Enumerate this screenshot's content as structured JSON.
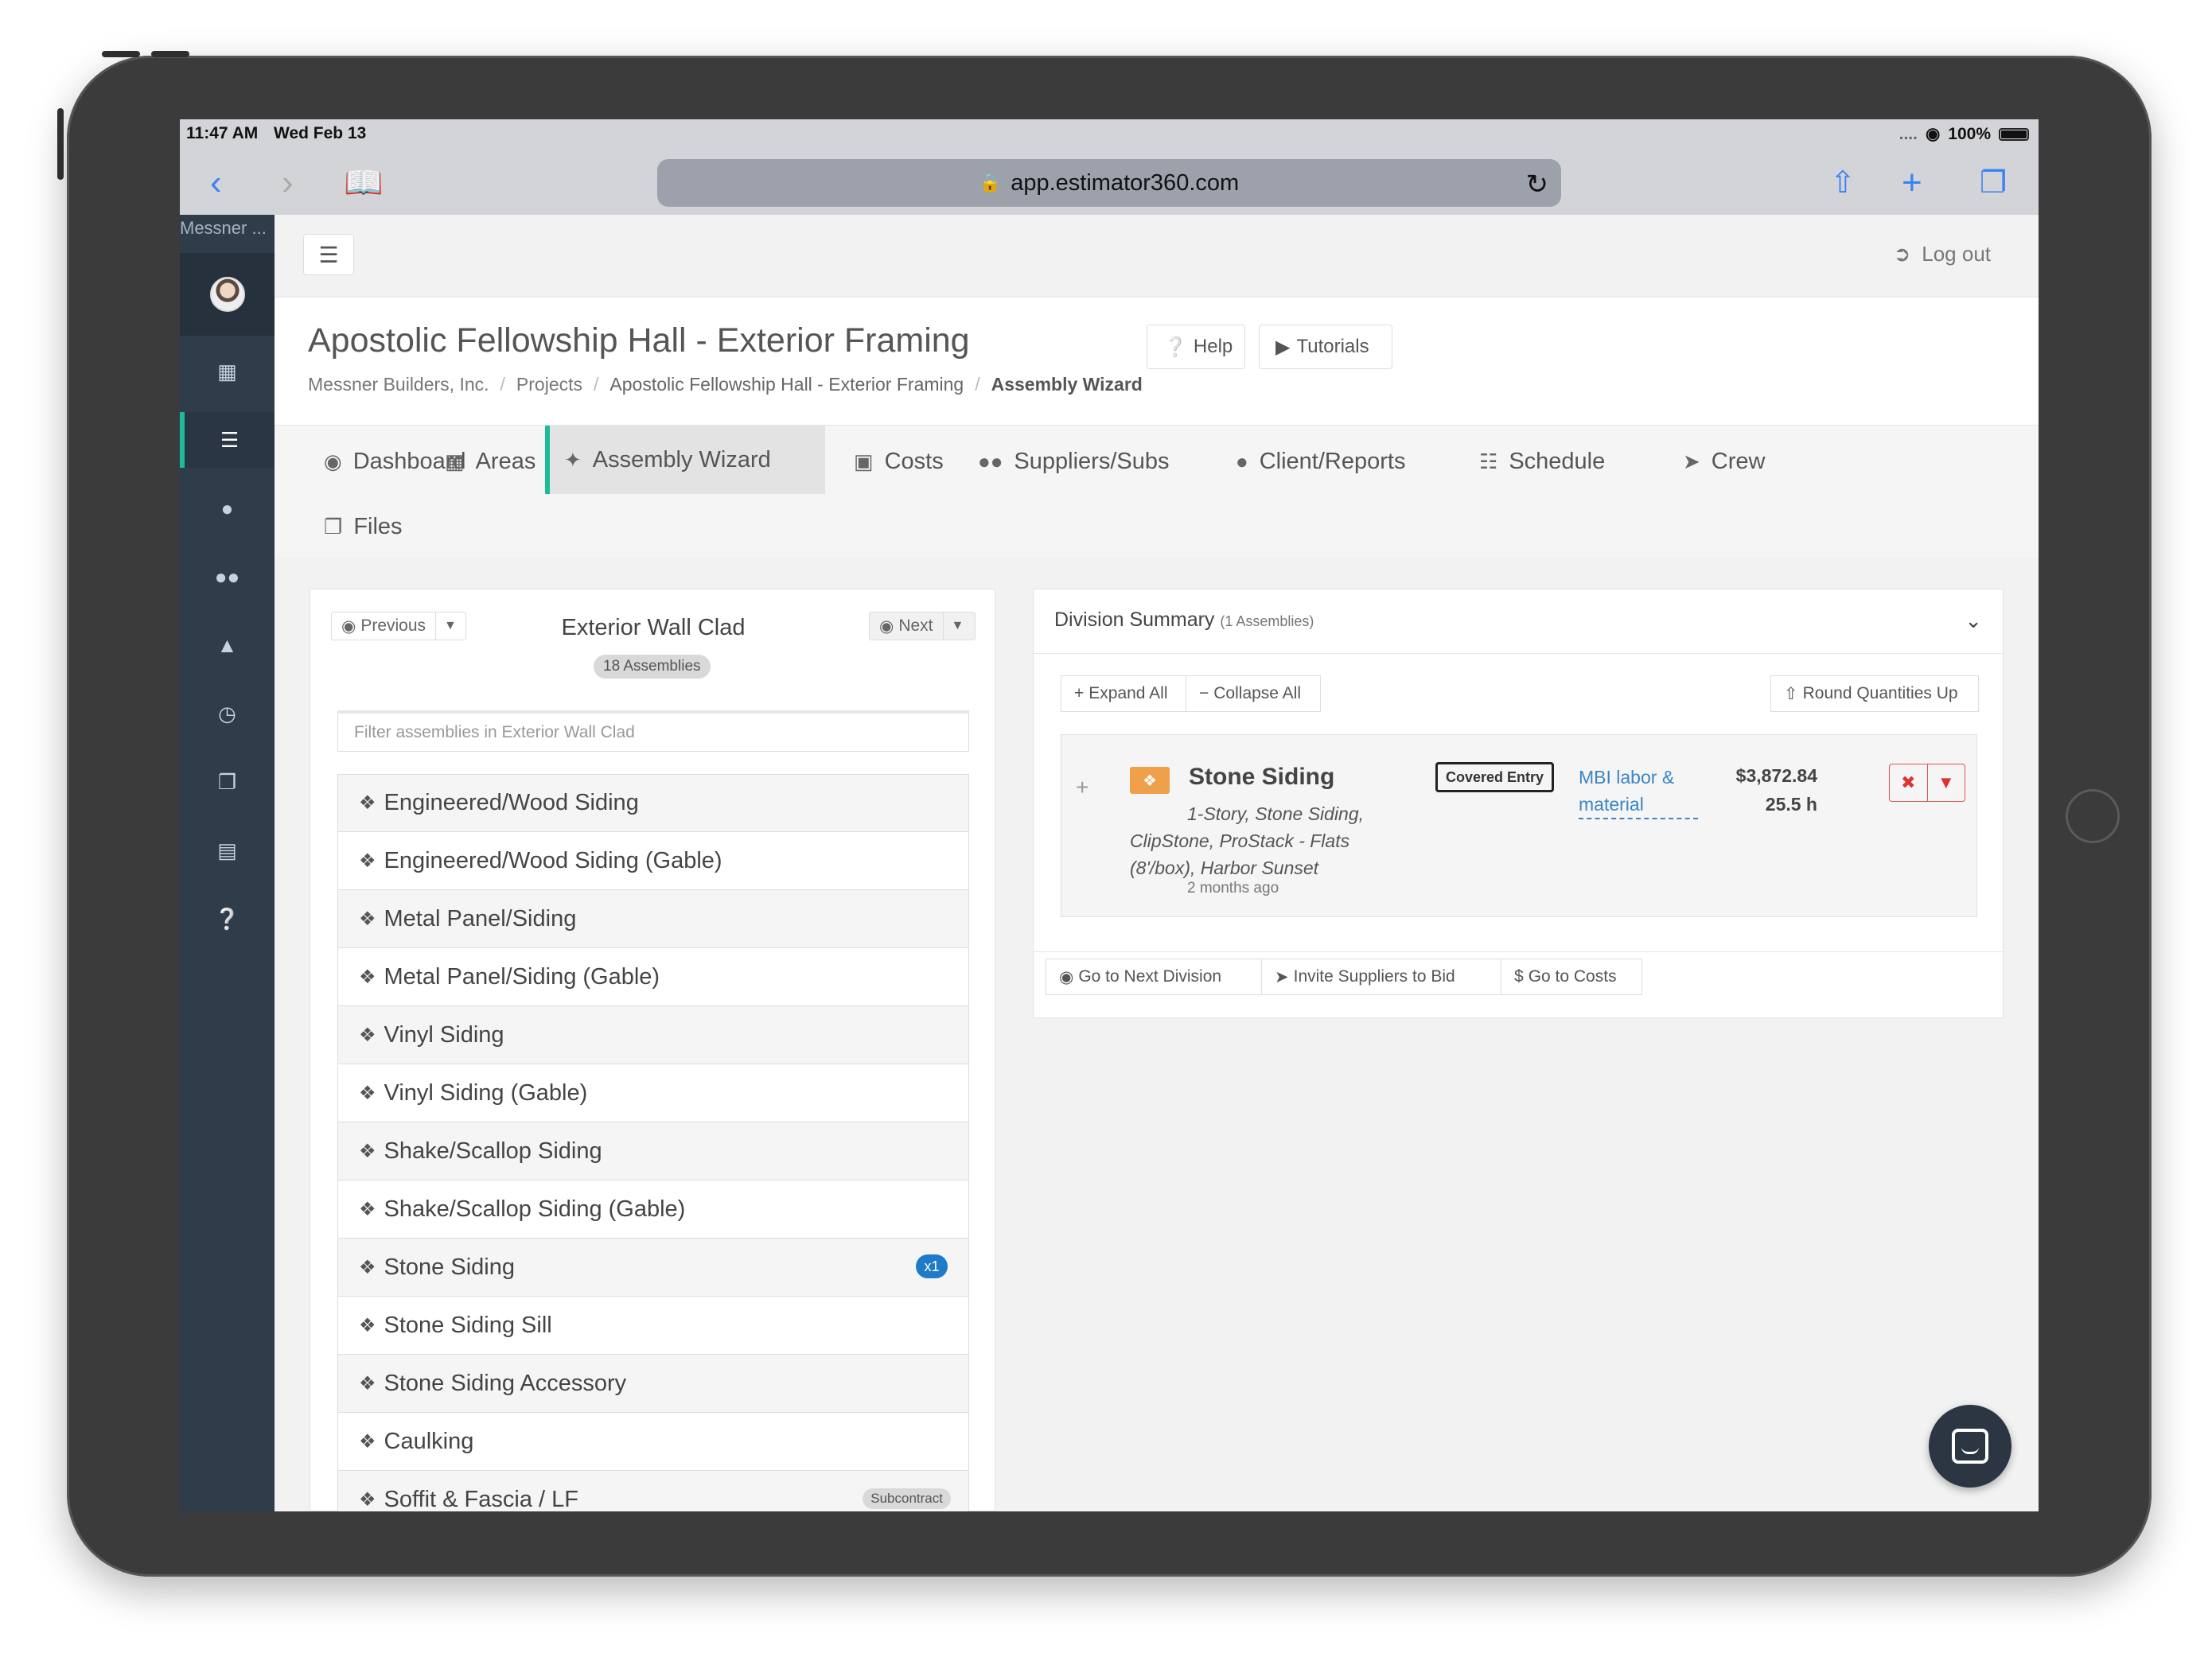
{
  "status": {
    "time": "11:47 AM",
    "date": "Wed Feb 13",
    "signal": "....",
    "battery": "100%"
  },
  "browser": {
    "url": "app.estimator360.com"
  },
  "sidebar": {
    "brand": "Messner ...",
    "items": [
      "avatar",
      "dashboard-icon",
      "list-icon",
      "user-icon",
      "users-icon",
      "chart-icon",
      "clock-icon",
      "files-icon",
      "billing-icon",
      "help-icon"
    ]
  },
  "appbar": {
    "logout": "Log out"
  },
  "header": {
    "title": "Apostolic Fellowship Hall - Exterior Framing",
    "breadcrumb": [
      "Messner Builders, Inc.",
      "Projects",
      "Apostolic Fellowship Hall - Exterior Framing",
      "Assembly Wizard"
    ],
    "help": "Help",
    "tutorials": "Tutorials"
  },
  "tabs": [
    {
      "label": "Dashboard",
      "icon": "dashboard-icon"
    },
    {
      "label": "Areas",
      "icon": "grid-icon"
    },
    {
      "label": "Assembly Wizard",
      "icon": "wand-icon",
      "active": true
    },
    {
      "label": "Costs",
      "icon": "money-icon"
    },
    {
      "label": "Suppliers/Subs",
      "icon": "users-icon"
    },
    {
      "label": "Client/Reports",
      "icon": "user-icon"
    },
    {
      "label": "Schedule",
      "icon": "calendar-icon"
    },
    {
      "label": "Crew",
      "icon": "megaphone-icon"
    },
    {
      "label": "Files",
      "icon": "files-icon"
    }
  ],
  "left": {
    "previous": "Previous",
    "next": "Next",
    "division": "Exterior Wall Clad",
    "count": "18 Assemblies",
    "filter_placeholder": "Filter assemblies in Exterior Wall Clad",
    "items": [
      {
        "label": "Engineered/Wood Siding"
      },
      {
        "label": "Engineered/Wood Siding (Gable)"
      },
      {
        "label": "Metal Panel/Siding"
      },
      {
        "label": "Metal Panel/Siding (Gable)"
      },
      {
        "label": "Vinyl Siding"
      },
      {
        "label": "Vinyl Siding (Gable)"
      },
      {
        "label": "Shake/Scallop Siding"
      },
      {
        "label": "Shake/Scallop Siding (Gable)"
      },
      {
        "label": "Stone Siding",
        "badge": "x1"
      },
      {
        "label": "Stone Siding Sill"
      },
      {
        "label": "Stone Siding Accessory"
      },
      {
        "label": "Caulking"
      },
      {
        "label": "Soffit & Fascia / LF",
        "tag": "Subcontract"
      }
    ]
  },
  "right": {
    "title": "Division Summary",
    "subtitle": "(1 Assemblies)",
    "expand_all": "Expand All",
    "collapse_all": "Collapse All",
    "round_up": "Round Quantities Up",
    "card": {
      "name": "Stone Siding",
      "description": "1-Story, Stone Siding, ClipStone, ProStack - Flats (8'/box), Harbor Sunset",
      "ago": "2 months ago",
      "tag": "Covered Entry",
      "link": "MBI labor & material",
      "price": "$3,872.84",
      "hours": "25.5 h"
    },
    "footer": {
      "next_division": "Go to Next Division",
      "invite": "Invite Suppliers to Bid",
      "costs": "Go to Costs"
    }
  },
  "colors": {
    "accent": "#1abc9c",
    "sidebar": "#2f3c4a",
    "link": "#3a85c8",
    "badge": "#1f7ac8",
    "danger": "#e05555",
    "orange": "#f0a04b"
  }
}
